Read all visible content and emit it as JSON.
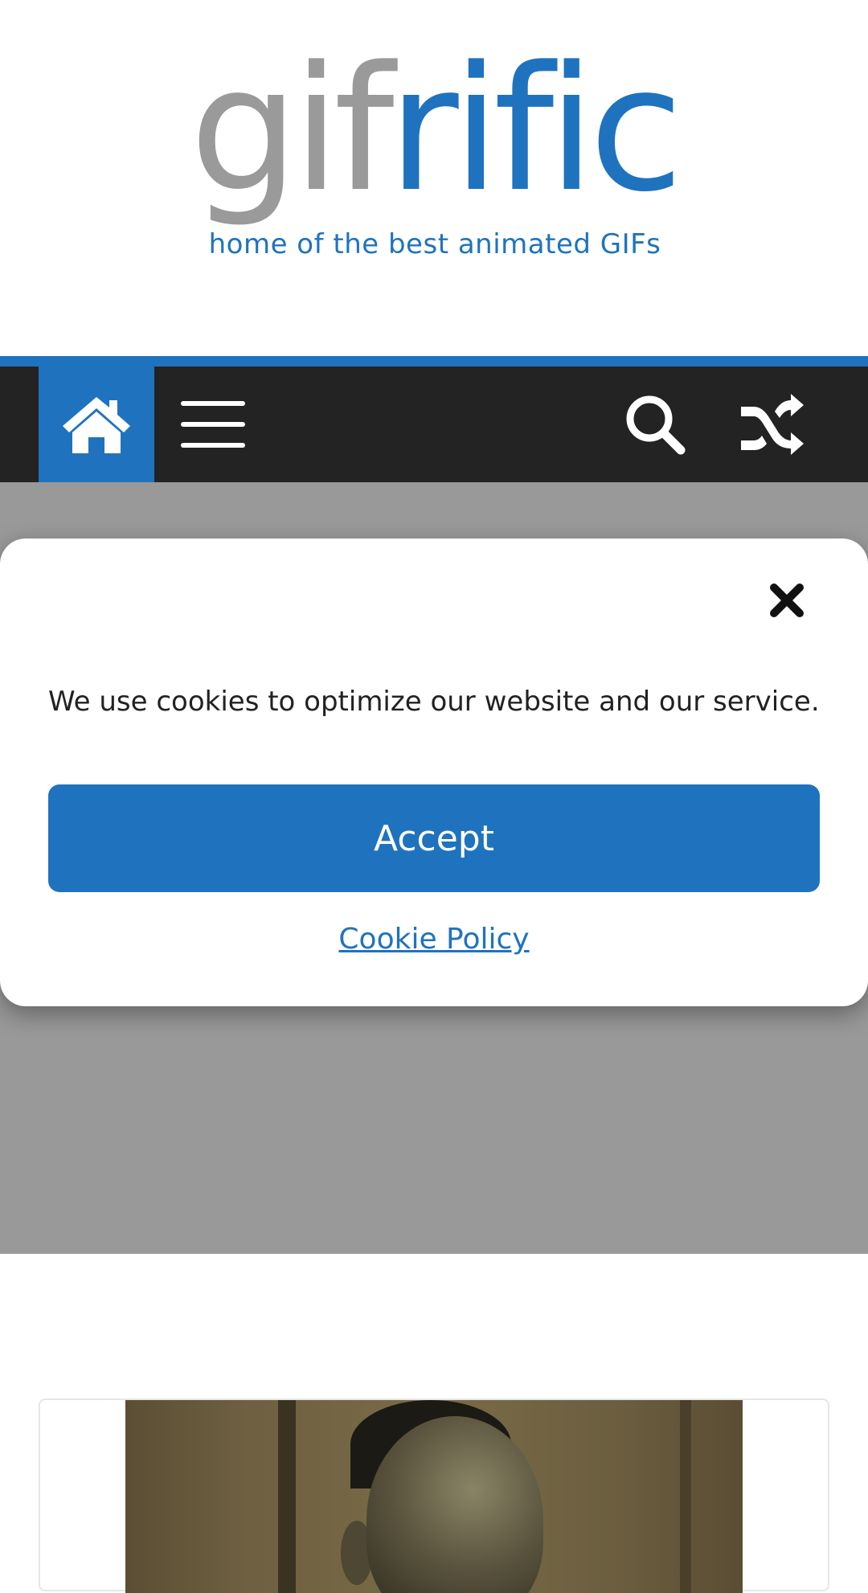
{
  "header": {
    "logo": {
      "part_gray": "gif",
      "part_blue": "rific",
      "tagline": "home of the best animated GIFs"
    }
  },
  "nav": {
    "icons": [
      "home-icon",
      "menu-icon",
      "search-icon",
      "shuffle-icon"
    ]
  },
  "cookie_banner": {
    "message": "We use cookies to optimize our website and our service.",
    "accept_label": "Accept",
    "policy_link": "Cookie Policy"
  },
  "colors": {
    "brand_blue": "#1f73be",
    "nav_background": "#232323",
    "overlay_grey": "#999999",
    "logo_grey": "#9a9a9a"
  }
}
